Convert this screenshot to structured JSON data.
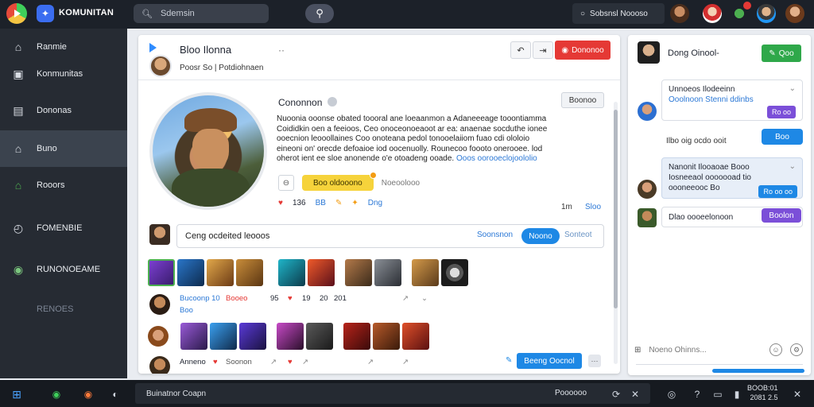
{
  "topbar": {
    "app_name": "KOMUNITAN",
    "search_placeholder": "Sdemsin",
    "search2_text": "Sobsnsl Noooso",
    "search_btn_icon": "magnifier-icon"
  },
  "sidebar": {
    "items": [
      {
        "label": "Ranmie",
        "icon": "home-icon"
      },
      {
        "label": "Konmunitas",
        "icon": "folder-icon"
      },
      {
        "label": "Dononas",
        "icon": "calendar-icon"
      },
      {
        "label": "Buno",
        "icon": "home-icon"
      },
      {
        "label": "Rooors",
        "icon": "home-colored-icon"
      },
      {
        "label": "FOMENBIE",
        "icon": "clock-icon"
      },
      {
        "label": "RUNONOEAME",
        "icon": "globe-icon"
      },
      {
        "label": "RENOES",
        "icon": ""
      }
    ]
  },
  "main": {
    "header_title": "Bloo Ilonna",
    "header_dots": "··",
    "header_sub": "Poosr So | Potdiohnaen",
    "red_btn_label": "Dononoo",
    "community_title": "Cononnon",
    "community_btn": "Boonoo",
    "desc_lines": [
      "Nuoonia ooonse obated toooral ane loeaanmon a Adaneeeage tooontiamma",
      "Coididkin oen a feeioos, Ceo onoceonoeaoot ar ea: anaenae socduthe ionee",
      "ooecnion leooollaines Coo onoteana pedol tonooelaiiom fuao cdi ololoio",
      "eineoni on' orecde defoaioe iod oocenuolly. Rounecoo foooto onerooee. lod",
      "oherot ient ee sloe anonende o'e otoadeng ooade."
    ],
    "desc_links": [
      "tonooelaiiom",
      "foooto onerooee",
      "Ooos oorooeclojoololio"
    ],
    "chip_label": "Boo oldooono",
    "chip_text": "Noeoolooo",
    "stats": [
      "136",
      "BB",
      "Dng"
    ],
    "stat_right1": "1m",
    "stat_right2": "Sloo",
    "comment_placeholder": "Ceng ocdeited leooos",
    "comment_link": "Soonsnon",
    "comment_primary": "Noono",
    "comment_ghost": "Sonteot",
    "row1": {
      "name": "Bucoonp 10",
      "tag": "Booeo",
      "sub": "Boo",
      "stats": [
        "95",
        "19",
        "20",
        "201"
      ]
    },
    "row2": {
      "name": "Anneno",
      "tag": "Soonon"
    },
    "post_btn": "Beeng Oocnol",
    "post_more": "···"
  },
  "right_panel": {
    "title": "Dong Oinool-",
    "green_btn": "Qoo",
    "msg1": {
      "title": "Unnoeos Ilodeeinn",
      "body": "Ooolnoon Stenni ddinbs",
      "pill": "Ro oo"
    },
    "msg2_line": "Ilbo oig ocdo ooit",
    "msg2_btn": "Boo",
    "msg3": {
      "title": "Nanonit Ilooaoae Booo",
      "body": "Iosneeaol ooooooad tio",
      "body2": "oooneeooc Bo",
      "pill": "Ro oo oo"
    },
    "msg4_line": "Dlao oooeelonoon",
    "purple_btn": "Boolon",
    "compose_placeholder": "Noeno Ohinns..."
  },
  "taskbar": {
    "field_text": "Buinatnor Coapn",
    "right_text": "Poooooo",
    "time_line1": "BOOB:01",
    "time_line2": "2081 2.5"
  },
  "colors": {
    "accent": "#1e88e5",
    "danger": "#e53935",
    "success": "#2fa84a",
    "purple": "#7b4fd8",
    "sidebar_bg": "#262b33"
  }
}
